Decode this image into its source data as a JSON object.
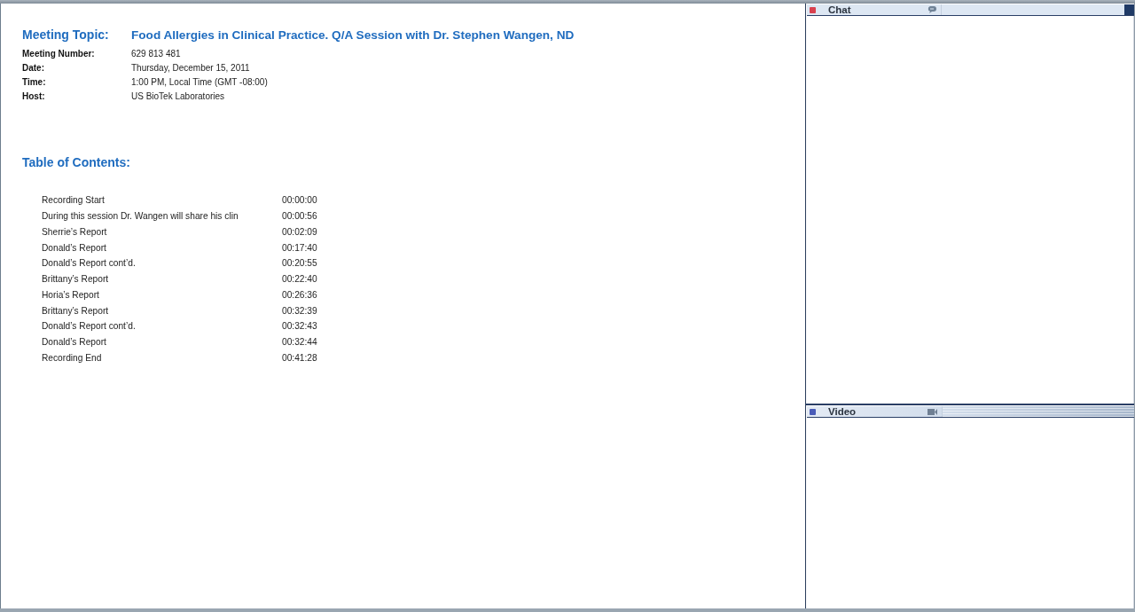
{
  "meeting": {
    "topic_label": "Meeting Topic:",
    "topic": "Food Allergies in Clinical Practice. Q/A Session with Dr. Stephen Wangen, ND",
    "details": [
      {
        "label": "Meeting Number:",
        "value": "629 813 481"
      },
      {
        "label": "Date:",
        "value": "Thursday, December 15, 2011"
      },
      {
        "label": "Time:",
        "value": "1:00 PM, Local Time (GMT -08:00)"
      },
      {
        "label": "Host:",
        "value": "US BioTek Laboratories"
      }
    ]
  },
  "table_of_contents": {
    "title": "Table of Contents:",
    "entries": [
      {
        "title": "Recording Start",
        "time": "00:00:00"
      },
      {
        "title": "During this session Dr. Wangen will share his clin",
        "time": "00:00:56"
      },
      {
        "title": "Sherrie’s Report",
        "time": "00:02:09"
      },
      {
        "title": "Donald’s Report",
        "time": "00:17:40"
      },
      {
        "title": "Donald’s Report cont’d.",
        "time": "00:20:55"
      },
      {
        "title": "Brittany’s Report",
        "time": "00:22:40"
      },
      {
        "title": "Horia’s Report",
        "time": "00:26:36"
      },
      {
        "title": "Brittany’s Report",
        "time": "00:32:39"
      },
      {
        "title": "Donald’s Report cont’d.",
        "time": "00:32:43"
      },
      {
        "title": "Donald’s Report",
        "time": "00:32:44"
      },
      {
        "title": "Recording End",
        "time": "00:41:28"
      }
    ]
  },
  "panels": [
    {
      "kind": "chat",
      "title": "Chat",
      "color": "#d9414f"
    },
    {
      "kind": "video",
      "title": "Video",
      "color": "#4a5cb8"
    }
  ]
}
